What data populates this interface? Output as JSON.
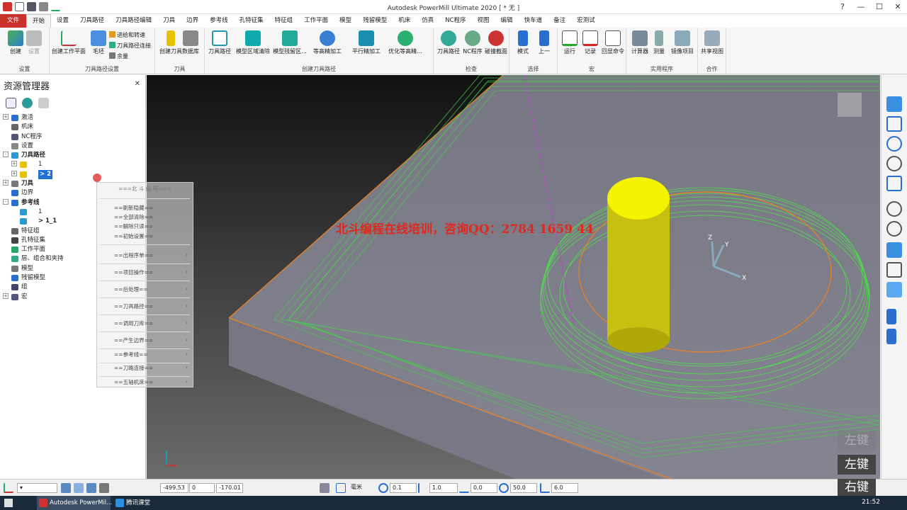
{
  "window": {
    "title": "Autodesk PowerMill Ultimate 2020   [ * 无 ]",
    "help": "?",
    "min": "—",
    "max": "☐",
    "close": "✕"
  },
  "tabs": [
    "文件",
    "开始",
    "设置",
    "刀具路径",
    "刀具路径编辑",
    "刀具",
    "边界",
    "参考线",
    "孔特征集",
    "特征组",
    "工作平面",
    "模型",
    "残留模型",
    "机床",
    "仿真",
    "NC程序",
    "视图",
    "编辑",
    "快车道",
    "备注",
    "宏测试"
  ],
  "active_tab": "开始",
  "ribbon": {
    "groups": [
      "设置",
      "刀具路径设置",
      "刀具",
      "创建刀具路径",
      "检查",
      "选择",
      "宏",
      "实用程序",
      "合作"
    ],
    "setup": {
      "create": "创建",
      "settings": "设置"
    },
    "toolpath_setup": {
      "create_workplane": "创建工作平面",
      "block": "毛坯",
      "feed": "进给和转速",
      "links": "刀具路径连接",
      "allowance": "余量"
    },
    "tool": {
      "create_tool": "创建刀具",
      "database": "数据库"
    },
    "create_toolpath": {
      "toolpath": "刀具路径",
      "model_area_clear": "模型区域清除",
      "model_rest": "模型残留区...",
      "constant_z": "等高精加工",
      "raster": "平行精加工",
      "opt_constant_z": "优化等高精..."
    },
    "verify": {
      "toolpath": "刀具路径",
      "nc": "NC程序",
      "collision": "碰撞截面"
    },
    "select": {
      "mode": "模式",
      "previous": "上一"
    },
    "macro": {
      "run": "运行",
      "record": "记录",
      "echo": "回显命令"
    },
    "utilities": {
      "calculator": "计算器",
      "measure": "测量",
      "mirror": "镜像项目"
    },
    "collab": {
      "share_view": "共享视图"
    }
  },
  "explorer": {
    "title": "资源管理器",
    "nodes": [
      {
        "label": "激活",
        "bold": false
      },
      {
        "label": "机床",
        "bold": false
      },
      {
        "label": "NC程序",
        "bold": false
      },
      {
        "label": "设置",
        "bold": false
      },
      {
        "label": "刀具路径",
        "bold": true
      },
      {
        "label": "1",
        "bold": false
      },
      {
        "label": "> 2",
        "bold": true
      },
      {
        "label": "刀具",
        "bold": true
      },
      {
        "label": "边界",
        "bold": false
      },
      {
        "label": "参考线",
        "bold": true
      },
      {
        "label": "1",
        "bold": false
      },
      {
        "label": "> 1_1",
        "bold": true
      },
      {
        "label": "特征组",
        "bold": false
      },
      {
        "label": "孔特征集",
        "bold": false
      },
      {
        "label": "工作平面",
        "bold": false
      },
      {
        "label": "层、组合和夹持",
        "bold": false
      },
      {
        "label": "模型",
        "bold": false
      },
      {
        "label": "残留模型",
        "bold": false
      },
      {
        "label": "组",
        "bold": false
      },
      {
        "label": "宏",
        "bold": false
      }
    ]
  },
  "context_menu": {
    "header": "===北 斗 编 程===",
    "items": [
      "==刷新隐藏==",
      "==全部清除==",
      "==解除只读==",
      "==初始设置==",
      "==出程序单==",
      "==项目操作==",
      "==后处理==",
      "==刀具路径==",
      "==调用刀库==",
      "==产生边界==",
      "==参考线==",
      "==刀路连接==",
      "==五轴机床=="
    ]
  },
  "viewport": {
    "watermark": "北斗编程在线培训，咨询QQ：2784 1659 44",
    "axis_z": "Z",
    "axis_y": "Y",
    "axis_x": "X",
    "key_left_dim": "左键",
    "key_left": "左键",
    "key_right": "右键"
  },
  "statusbar": {
    "x": "-499.53",
    "y": "0",
    "z": "-170.01",
    "unit": "毫米",
    "tolerance": "0.1",
    "thickness": "1.0",
    "offset": "0.0",
    "diameter": "50.0",
    "angle": "6.0"
  },
  "taskbar": {
    "app1": "Autodesk PowerMil...",
    "app2": "腾讯课堂",
    "time": "21:52"
  }
}
